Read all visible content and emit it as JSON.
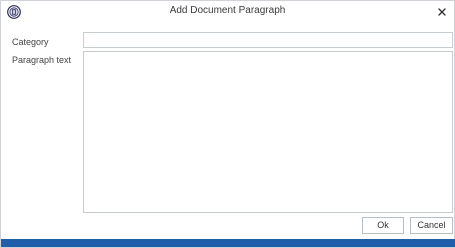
{
  "window": {
    "title": "Add Document Paragraph",
    "close_symbol": "×",
    "accent_color": "#1f5fa9"
  },
  "form": {
    "category_label": "Category",
    "category_value": "",
    "paragraph_label": "Paragraph text",
    "paragraph_value": ""
  },
  "buttons": {
    "ok_label": "Ok",
    "cancel_label": "Cancel"
  },
  "icons": {
    "app": "app-logo-icon",
    "close": "close-icon"
  }
}
